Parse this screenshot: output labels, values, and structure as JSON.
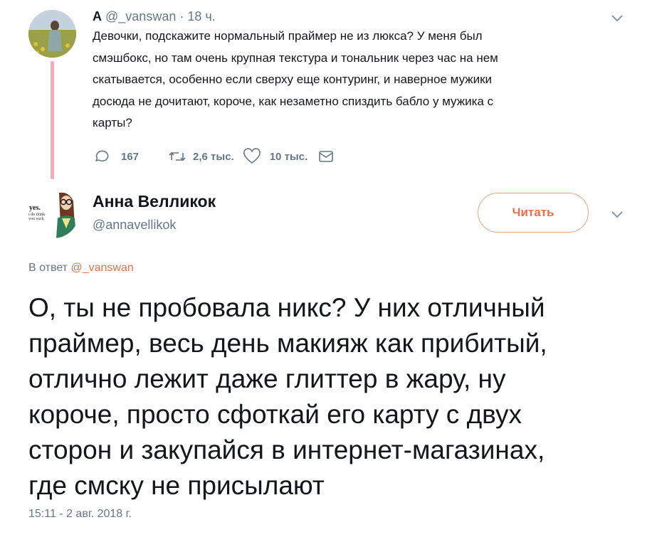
{
  "parent_tweet": {
    "name": "A",
    "handle": "@_vanswan",
    "separator": "·",
    "time": "18 ч.",
    "text_lines": [
      "Девочки, подскажите нормальный праймер не из люкса? У меня был",
      "смэшбокс,  но там очень крупная текстура и тональник через час на нем",
      "скатывается,  особенно если сверху еще контуринг, и наверное мужики",
      "досюда не  дочитают, короче, как незаметно спиздить бабло у мужика с",
      "карты?"
    ],
    "replies": "167",
    "retweets": "2,6 тыс.",
    "likes": "10 тыс.",
    "icons": [
      "reply-icon",
      "retweet-icon",
      "like-icon",
      "direct-message-icon",
      "chevron-down-icon"
    ]
  },
  "reply_tweet": {
    "name": "Анна Велликок",
    "handle": "@annavellikok",
    "follow_label": "Читать",
    "reply_to_prefix": "В ответ",
    "reply_to_mention": "@_vanswan",
    "avatar_text": [
      "yes.",
      "i do think",
      "you suck"
    ],
    "text_lines": [
      "О, ты не пробовала никс? У них отличный",
      "праймер, весь день макияж как прибитый,",
      "отлично лежит даже глиттер в жару, ну",
      "короче, просто сфоткай его карту с двух",
      "сторон и закупайся в интернет-магазинах,",
      "где смску не присылают"
    ],
    "timestamp": "15:11 - 2 авг. 2018 г."
  },
  "colors": {
    "accent": "#e8704a",
    "thread_line": "#f4abba",
    "secondary_text": "#657786",
    "primary_text": "#14171a"
  }
}
